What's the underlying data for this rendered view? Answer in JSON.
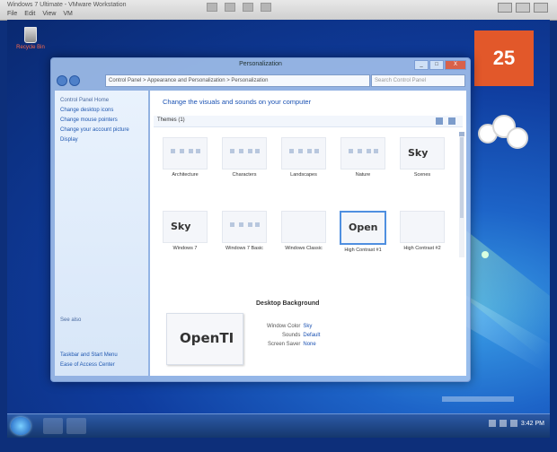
{
  "host": {
    "title": "Windows 7 Ultimate - VMware Workstation",
    "menu": [
      "File",
      "Edit",
      "View",
      "VM"
    ],
    "toolbar_icons": [
      "power-icon",
      "pause-icon",
      "snapshot-icon",
      "fullscreen-icon"
    ]
  },
  "desktop": {
    "icons": [
      {
        "label": "Recycle Bin",
        "icon": "recycle-bin-icon"
      }
    ],
    "gadget_orange_symbol": "25",
    "accent_color": "#e2582a"
  },
  "window": {
    "title": "Personalization",
    "controls": [
      "_",
      "□",
      "X"
    ],
    "address": "Control Panel > Appearance and Personalization > Personalization",
    "search_placeholder": "Search Control Panel",
    "left_pane": {
      "head": "Control Panel Home",
      "links": [
        "Change desktop icons",
        "Change mouse pointers",
        "Change your account picture",
        "Display"
      ],
      "see_also_head": "See also",
      "see_also": [
        "Taskbar and Start Menu",
        "Ease of Access Center"
      ]
    },
    "main": {
      "heading": "Change the visuals and sounds on your computer",
      "info_label": "Themes (1)",
      "themes": [
        {
          "label": "Architecture",
          "kind": "dots"
        },
        {
          "label": "Characters",
          "kind": "dots"
        },
        {
          "label": "Landscapes",
          "kind": "dots"
        },
        {
          "label": "Nature",
          "kind": "dots"
        },
        {
          "label": "Scenes",
          "kind": "logo",
          "logo": "Sky"
        },
        {
          "label": "Windows 7",
          "kind": "logo",
          "logo": "Sky"
        },
        {
          "label": "Windows 7 Basic",
          "kind": "dots"
        },
        {
          "label": "Windows Classic",
          "kind": "blank"
        },
        {
          "label": "High Contrast #1",
          "kind": "logo",
          "logo": "Open"
        },
        {
          "label": "High Contrast #2",
          "kind": "blank"
        }
      ],
      "selected_theme": "High Contrast #1",
      "bottom_title": "Desktop Background",
      "big_logo": "OpenTI",
      "props": [
        {
          "k": "Window Color",
          "v": "Sky"
        },
        {
          "k": "Sounds",
          "v": "Default"
        },
        {
          "k": "Screen Saver",
          "v": "None"
        }
      ]
    }
  },
  "taskbar": {
    "clock": "3:42 PM"
  }
}
